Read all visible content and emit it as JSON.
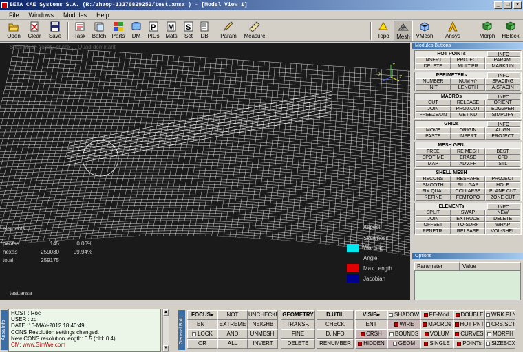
{
  "window": {
    "title": "BETA CAE Systems S.A. (R:/zhaop-13376829252/test.ansa ) - [Model View 1]",
    "controls": [
      "_",
      "□",
      "×"
    ]
  },
  "menu": [
    "File",
    "Windows",
    "Modules",
    "Help"
  ],
  "toolbar": {
    "left": [
      "Open",
      "Clear",
      "Save",
      "Task",
      "Batch",
      "Parts",
      "DM",
      "PIDs",
      "Mats",
      "Set",
      "DB",
      "Param",
      "Measure"
    ],
    "right": [
      "Topo",
      "Mesh",
      "VMesh",
      "Ansys",
      "Morph",
      "HBlock"
    ],
    "active": "Mesh"
  },
  "viewport": {
    "header_text": "Shell Mesh quality check ... Quad dominant",
    "stats": {
      "heading": "elements",
      "rows": [
        {
          "label": "pentas",
          "count": "145",
          "pct": "0.06%"
        },
        {
          "label": "hexas",
          "count": "259030",
          "pct": "99.94%"
        },
        {
          "label": "total",
          "count": "259175",
          "pct": ""
        }
      ]
    },
    "filename": "test.ansa",
    "legend": [
      {
        "label": "Aspect",
        "color": ""
      },
      {
        "label": "Skewness",
        "color": ""
      },
      {
        "label": "Warping",
        "color": "#00e5ee"
      },
      {
        "label": "Angle",
        "color": ""
      },
      {
        "label": "Max Length",
        "color": "#e00000"
      },
      {
        "label": "Jacobian",
        "color": "#000090"
      }
    ],
    "axis": {
      "x": "X",
      "y": "Y",
      "z": "Z"
    }
  },
  "modules": {
    "title": "Modules Buttons",
    "groups": [
      {
        "name": "HOT POINTs",
        "info": "INFO",
        "rows": [
          [
            "INSERT",
            "PROJECT",
            "PARAM."
          ],
          [
            "DELETE",
            "MULT.PR",
            "MARK/UN"
          ]
        ]
      },
      {
        "name": "PERIMETERs",
        "info": "INFO",
        "rows": [
          [
            "NUMBER",
            "NUM +/-",
            "SPACING"
          ],
          [
            "INIT",
            "LENGTH",
            "A.SPACIN"
          ]
        ]
      },
      {
        "name": "MACROs",
        "info": "INFO",
        "rows": [
          [
            "CUT",
            "RELEASE",
            "ORIENT"
          ],
          [
            "JOIN",
            "PROJ.CUT",
            "EDG2PER"
          ],
          [
            "FREEZE/UN",
            "GET ND",
            "SIMPLIFY"
          ]
        ]
      },
      {
        "name": "GRIDs",
        "info": "INFO",
        "rows": [
          [
            "MOVE",
            "ORIGIN",
            "ALIGN"
          ],
          [
            "PASTE",
            "INSERT",
            "PROJECT"
          ]
        ]
      },
      {
        "name": "MESH GEN.",
        "info": "",
        "rows": [
          [
            "FREE",
            "RE MESH",
            "BEST"
          ],
          [
            "SPOT-ME",
            "ERASE",
            "CFD"
          ],
          [
            "MAP",
            "ADV.FR",
            "STL"
          ]
        ]
      },
      {
        "name": "SHELL MESH",
        "info": "",
        "rows": [
          [
            "RECONS",
            "RESHAPE",
            "PROJECT"
          ],
          [
            "SMOOTH",
            "FILL GAP",
            "HOLE"
          ],
          [
            "FIX QUAL",
            "COLLAPSE",
            "PLANE CUT"
          ],
          [
            "REFINE",
            "FEMTOPO",
            "ZONE CUT"
          ]
        ]
      },
      {
        "name": "ELEMENTs",
        "info": "INFO",
        "rows": [
          [
            "SPLIT",
            "SWAP",
            "NEW"
          ],
          [
            "JOIN",
            "EXTRUDE",
            "DELETE"
          ],
          [
            "OFFSET",
            "TO-SURF",
            "WRAP"
          ],
          [
            "PENETR.",
            "RELEASE",
            "VOL-SHEL"
          ]
        ]
      }
    ]
  },
  "options": {
    "title": "Options",
    "columns": [
      "Parameter",
      "Value"
    ]
  },
  "bottom": {
    "ansa_info_tab": "Ansa Info",
    "general_tab": "General Butt.",
    "info_lines": [
      "HOST : Roc",
      "USER : zp",
      "DATE :16-MAY-2012 18:40:49",
      "CONS Resolution settings changed.",
      "New CONS resolution length: 0.5 (old: 0.4)"
    ],
    "watermark": "CM: www.SimWe.com",
    "focus": [
      [
        "FOCUS▸",
        "NOT",
        "UNCHECKE."
      ],
      [
        "ENT",
        "EXTREME",
        "NEIGHB"
      ],
      [
        "LOCK",
        "AND",
        "UNMESH."
      ],
      [
        "OR",
        "ALL",
        "INVERT"
      ]
    ],
    "geometry": [
      "GEOMETRY",
      "TRANSF.",
      "FINE",
      "DELETE"
    ],
    "dutil": [
      "D.UTIL",
      "CHECK",
      "D.INFO",
      "RENUMBER"
    ],
    "visib": [
      [
        "VISIB▸",
        "SHADOW",
        "FE-Mod.",
        "DOUBLE",
        "WRK.PLN"
      ],
      [
        "ENT",
        "WIRE",
        "MACROs",
        "HOT PNT",
        "CRS.SCT"
      ],
      [
        "CRSH",
        "BOUNDS",
        "VOLUM",
        "CURVES",
        "MORPH"
      ],
      [
        "HIDDEN",
        "GEOM",
        "SINGLE",
        "POINTs",
        "SIZEBOX"
      ]
    ]
  }
}
